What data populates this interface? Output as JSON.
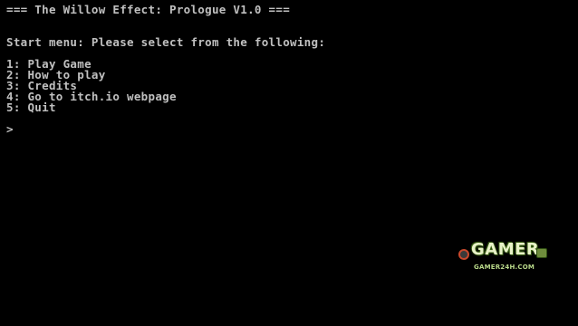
{
  "console": {
    "title_line": "=== The Willow Effect: Prologue V1.0 ===",
    "prompt_header": "Start menu: Please select from the following:",
    "menu_items": [
      "1: Play Game",
      "2: How to play",
      "3: Credits",
      "4: Go to itch.io webpage",
      "5: Quit"
    ],
    "input_prompt": ">",
    "text_color": "#c0c0c0",
    "background_color": "#000000"
  },
  "watermark": {
    "brand": "GAMER",
    "site": "GAMER24H.COM",
    "icons": [
      "gamepad-icon",
      "controller-badge-icon"
    ]
  }
}
